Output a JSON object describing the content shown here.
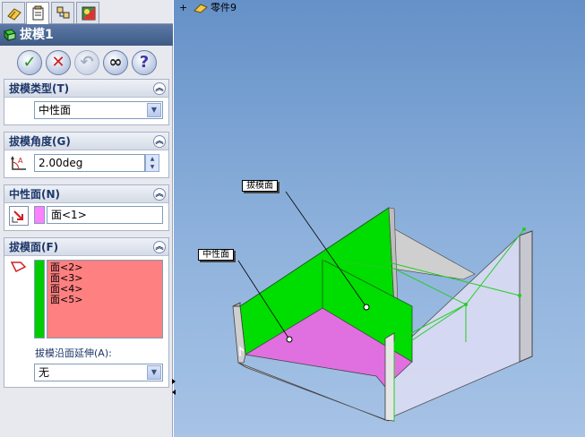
{
  "tree": {
    "expand_symbol": "+",
    "part_name": "零件9"
  },
  "feature": {
    "title": "拔模1"
  },
  "actions": {
    "ok": "✓",
    "cancel": "✕",
    "undo": "↶",
    "detail_preview": "∞",
    "help": "?"
  },
  "draft_type": {
    "header": "拔模类型(T)",
    "selected": "中性面"
  },
  "draft_angle": {
    "header": "拔模角度(G)",
    "value": "2.00deg"
  },
  "neutral_plane": {
    "header": "中性面(N)",
    "value": "面<1>"
  },
  "faces_to_draft": {
    "header": "拔模面(F)",
    "items": [
      "面<2>",
      "面<3>",
      "面<4>",
      "面<5>"
    ],
    "propagation_label": "拔模沿面延伸(A):",
    "propagation_value": "无"
  },
  "callouts": {
    "draft_faces": "拔模面",
    "neutral_plane": "中性面"
  },
  "colors": {
    "draft_face_green": "#00dd00",
    "neutral_face_magenta": "#e070e0",
    "list_background": "#fe8080",
    "viewport_top": "#6591c8",
    "viewport_bottom": "#a7c3e6"
  }
}
